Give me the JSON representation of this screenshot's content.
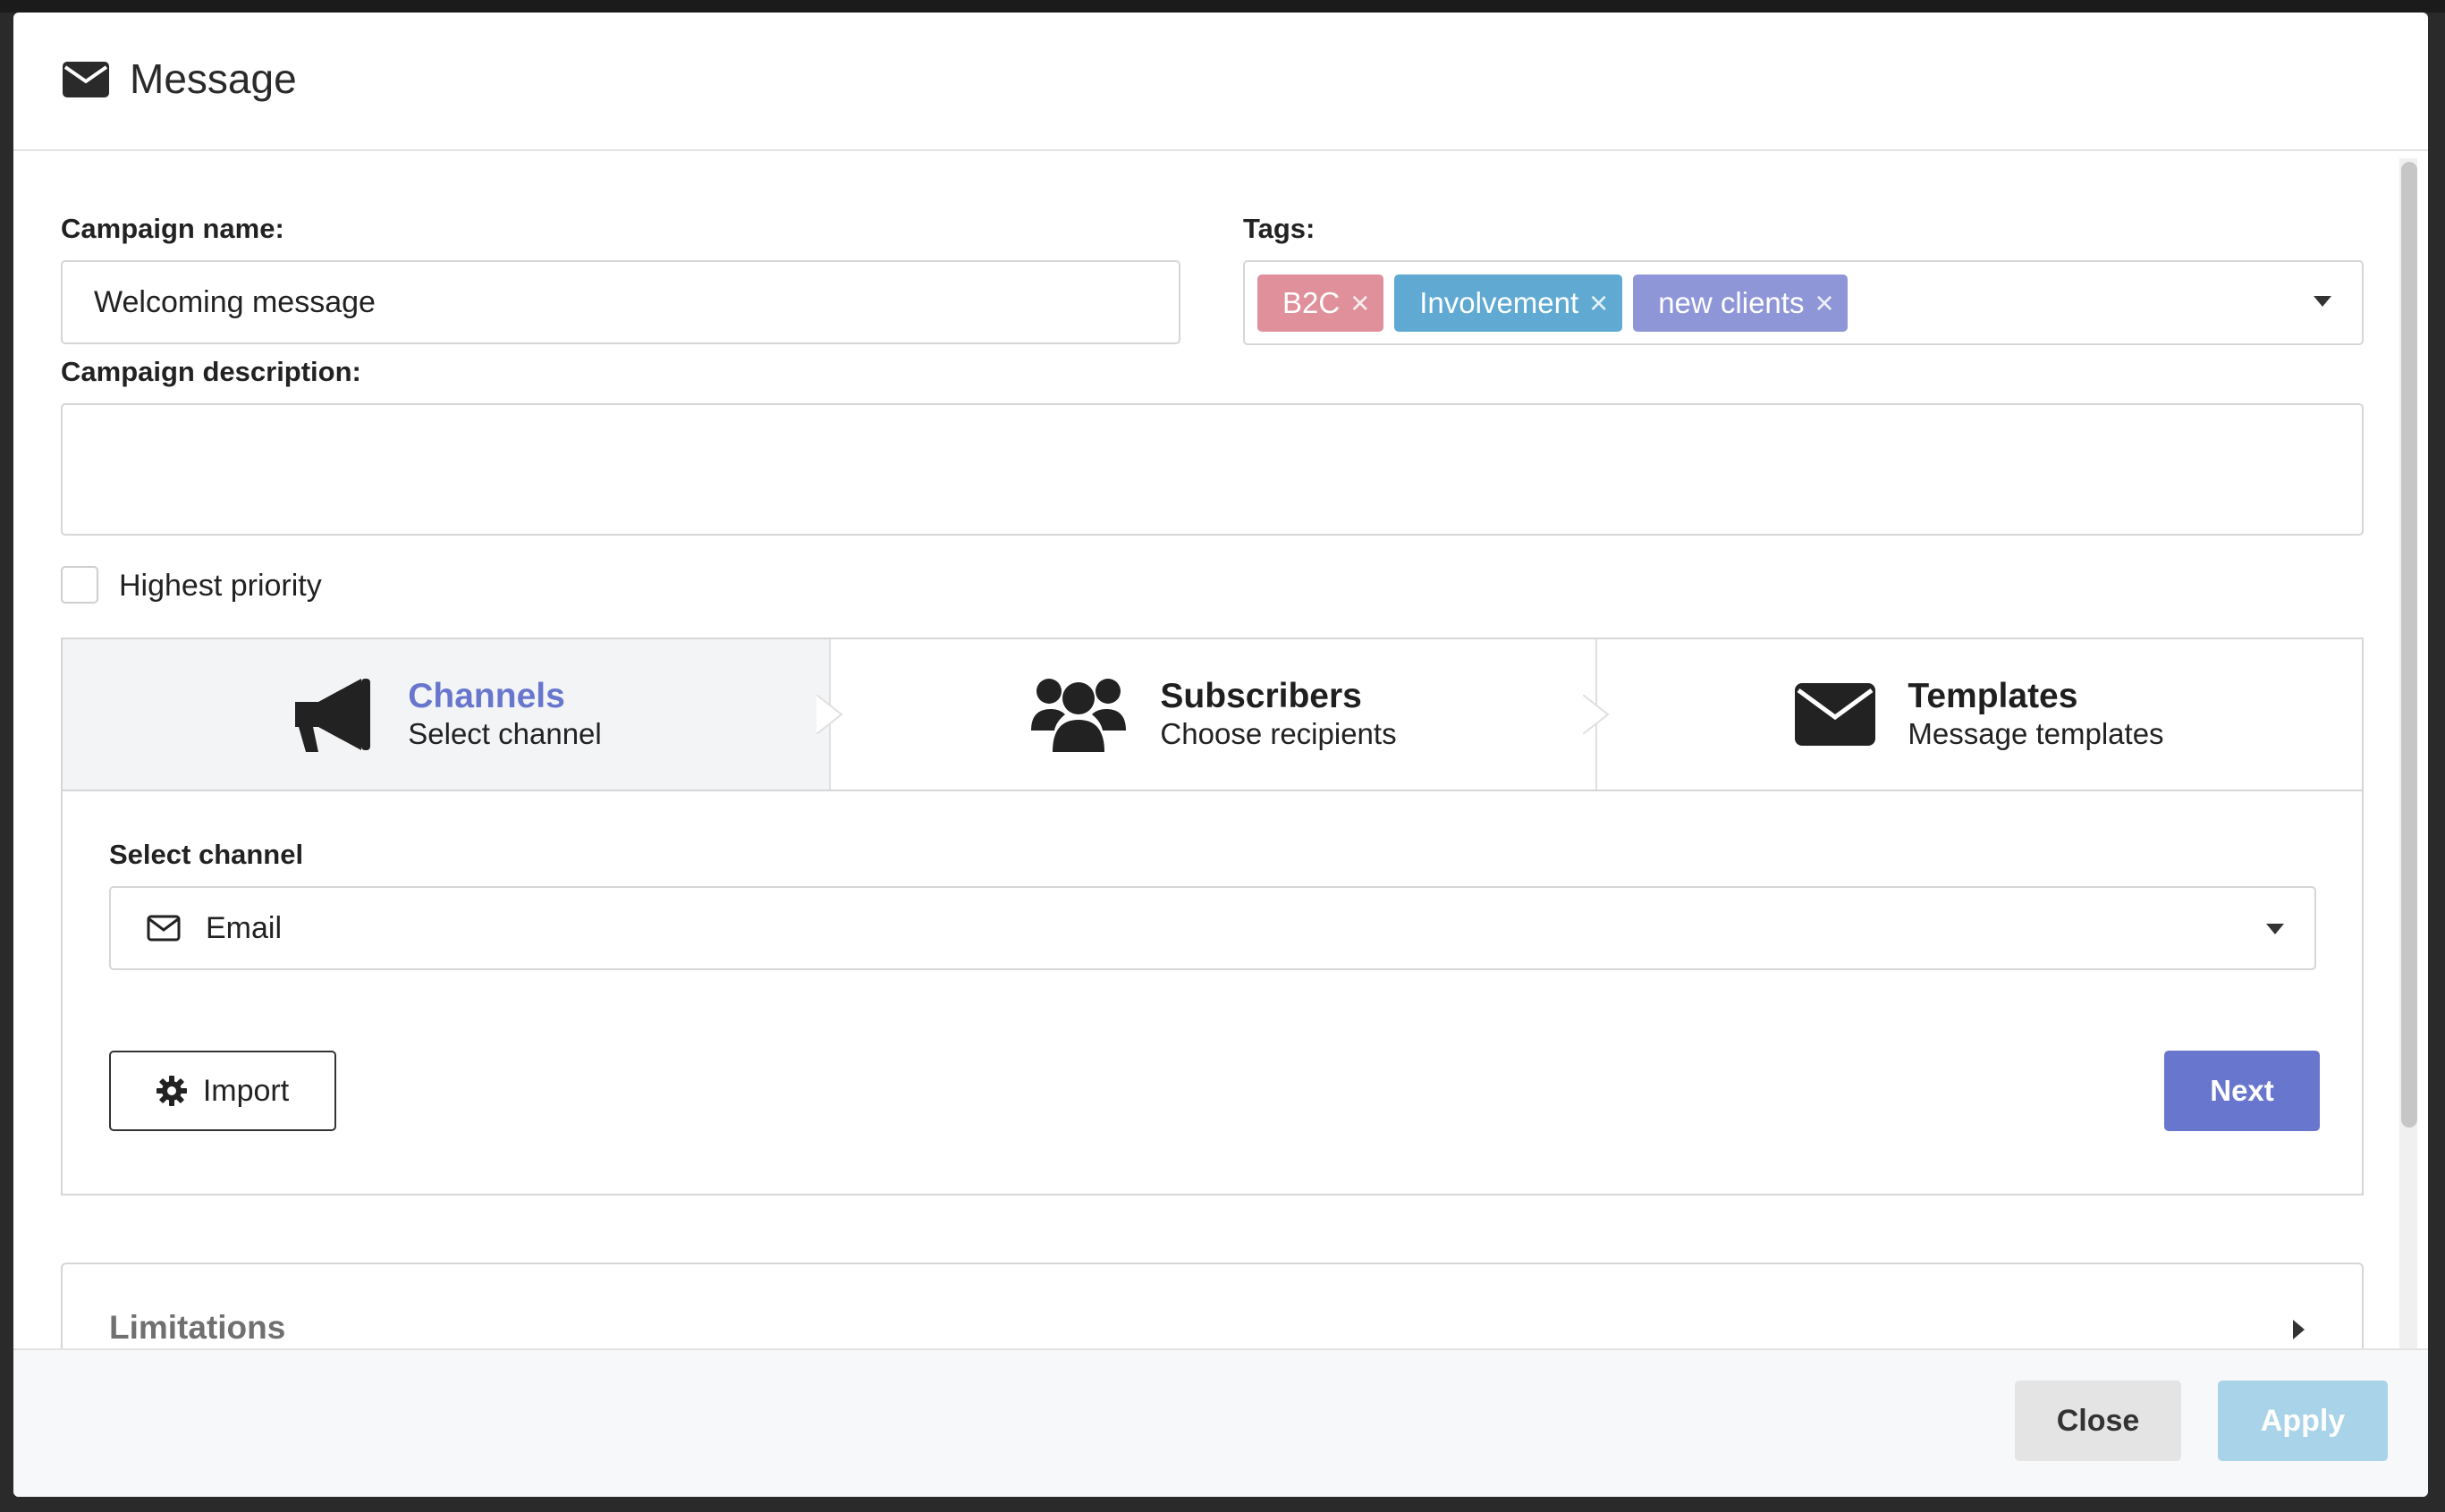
{
  "modal": {
    "title": "Message",
    "header_icon": "envelope-icon"
  },
  "form": {
    "campaign_name_label": "Campaign name:",
    "campaign_name_value": "Welcoming message",
    "tags_label": "Tags:",
    "tags": [
      {
        "label": "B2C",
        "color": "#e0909a"
      },
      {
        "label": "Involvement",
        "color": "#5fa9d3"
      },
      {
        "label": "new clients",
        "color": "#8f96d8"
      }
    ],
    "description_label": "Campaign description:",
    "description_value": "",
    "priority_label": "Highest priority",
    "priority_checked": false
  },
  "steps": [
    {
      "title": "Channels",
      "description": "Select channel",
      "icon": "megaphone-icon",
      "active": true
    },
    {
      "title": "Subscribers",
      "description": "Choose recipients",
      "icon": "users-icon",
      "active": false
    },
    {
      "title": "Templates",
      "description": "Message templates",
      "icon": "envelope-icon",
      "active": false
    }
  ],
  "channel_panel": {
    "label": "Select channel",
    "selected_value": "Email",
    "selected_icon": "envelope-outline-icon",
    "import_label": "Import",
    "import_icon": "gear-icon",
    "next_label": "Next"
  },
  "limitations": {
    "title": "Limitations"
  },
  "footer": {
    "close_label": "Close",
    "apply_label": "Apply"
  },
  "colors": {
    "accent": "#6877cd",
    "apply_disabled": "#a9d3e8"
  }
}
